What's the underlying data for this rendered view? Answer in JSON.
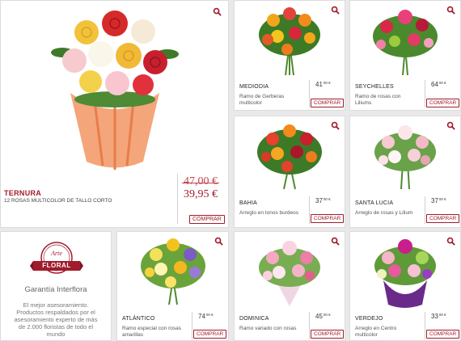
{
  "featured": {
    "name": "TERNURA",
    "description": "12 ROSAS MULTICOLOR DE TALLO CORTO",
    "old_price": "47,00 €",
    "new_price": "39,95 €",
    "buy_label": "COMPRAR"
  },
  "products": [
    {
      "name": "MEDIODIA",
      "description": "Ramo de Gerberas multicolor",
      "price": "41",
      "cents": "00 €",
      "buy_label": "COMPRAR"
    },
    {
      "name": "SEYCHELLES",
      "description": "Ramo de rosas con Liliums",
      "price": "64",
      "cents": "00 €",
      "buy_label": "COMPRAR"
    },
    {
      "name": "BAHIA",
      "description": "Arreglo en tonos burdeos",
      "price": "37",
      "cents": "00 €",
      "buy_label": "COMPRAR"
    },
    {
      "name": "SANTA LUCIA",
      "description": "Arreglo de rosas y Lilium",
      "price": "37",
      "cents": "00 €",
      "buy_label": "COMPRAR"
    },
    {
      "name": "ATLÁNTICO",
      "description": "Ramo especial con rosas amarillas",
      "price": "74",
      "cents": "00 €",
      "buy_label": "COMPRAR"
    },
    {
      "name": "DOMINICA",
      "description": "Ramo variado con rosas",
      "price": "45",
      "cents": "00 €",
      "buy_label": "COMPRAR"
    },
    {
      "name": "VERDEJO",
      "description": "Arreglo en Centro multicolor",
      "price": "33",
      "cents": "00 €",
      "buy_label": "COMPRAR"
    }
  ],
  "guarantee": {
    "logo_small": "Arte",
    "logo_big": "FLORAL",
    "title": "Garantía Interflora",
    "text": "El mejor asesoramiento. Productos respaldados por el asesoramiento experto de más de 2.000 floristas de todo el mundo"
  },
  "colors": {
    "accent": "#a01c2c",
    "background": "#e9e9e9",
    "card": "#ffffff"
  },
  "icons": {
    "zoom": "magnifier-icon"
  }
}
